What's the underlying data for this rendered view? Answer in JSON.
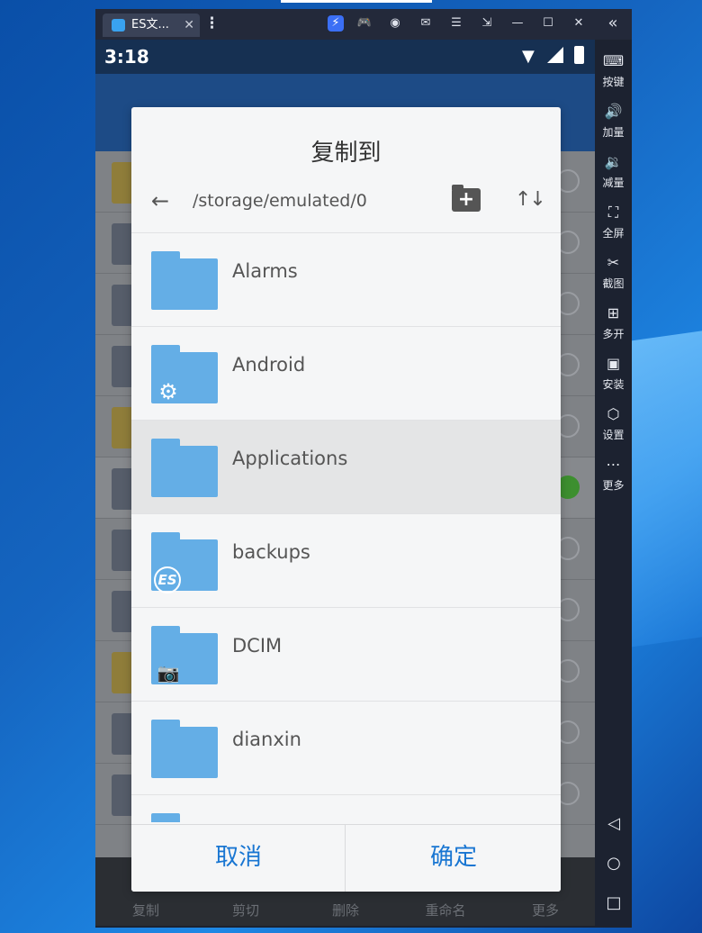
{
  "window": {
    "tab_title": "ES文...",
    "tab_close": "✕",
    "kebab": "⋮",
    "collapse": "«"
  },
  "statusbar": {
    "time": "3:18"
  },
  "background_app": {
    "bottom_bar": [
      "复制",
      "剪切",
      "删除",
      "重命名",
      "更多"
    ]
  },
  "side_panel": {
    "items": [
      {
        "label": "按键",
        "icon": "keyboard-icon",
        "glyph": "⌨"
      },
      {
        "label": "加量",
        "icon": "volume-up-icon",
        "glyph": "🔊"
      },
      {
        "label": "减量",
        "icon": "volume-down-icon",
        "glyph": "🔉"
      },
      {
        "label": "全屏",
        "icon": "fullscreen-icon",
        "glyph": "⛶"
      },
      {
        "label": "截图",
        "icon": "scissors-icon",
        "glyph": "✂"
      },
      {
        "label": "多开",
        "icon": "multi-instance-icon",
        "glyph": "⊞"
      },
      {
        "label": "安装",
        "icon": "apk-icon",
        "glyph": "▣"
      },
      {
        "label": "设置",
        "icon": "settings-icon",
        "glyph": "⬡"
      },
      {
        "label": "更多",
        "icon": "more-icon",
        "glyph": "⋯"
      }
    ],
    "nav": {
      "back": "◁",
      "home": "○",
      "recents": "□"
    }
  },
  "dialog": {
    "title": "复制到",
    "path": "/storage/emulated/0",
    "folders": [
      {
        "name": "Alarms",
        "badge": ""
      },
      {
        "name": "Android",
        "badge": "gear"
      },
      {
        "name": "Applications",
        "badge": "",
        "selected": true
      },
      {
        "name": "backups",
        "badge": "es"
      },
      {
        "name": "DCIM",
        "badge": "camera"
      },
      {
        "name": "dianxin",
        "badge": ""
      }
    ],
    "cancel_label": "取消",
    "confirm_label": "确定"
  },
  "colors": {
    "accent": "#1976d2",
    "folder": "#64aee6",
    "selected_row": "#e4e5e6"
  }
}
